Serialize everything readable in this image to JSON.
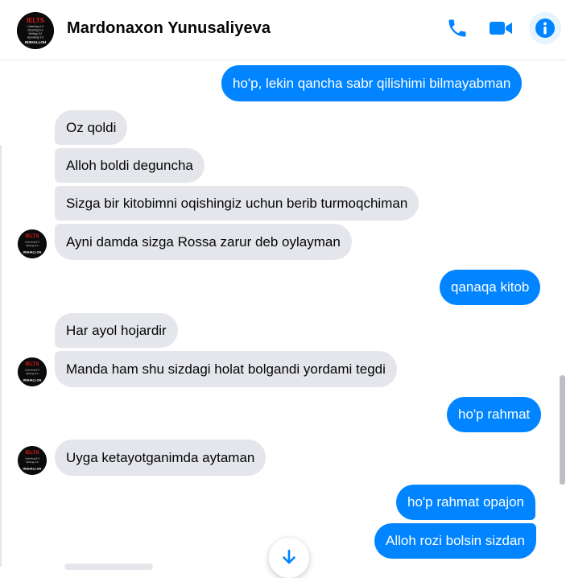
{
  "header": {
    "contact_name": "Mardonaxon Yunusaliyeva",
    "avatar_text": [
      "IELTS",
      "Listening 9.0",
      "Reading 9.0",
      "Writing 9.0",
      "Speaking 9.0",
      "INSHALLOH"
    ],
    "icons": [
      "phone-icon",
      "video-call-icon",
      "info-icon"
    ]
  },
  "colors": {
    "accent": "#0084ff",
    "incoming_bubble": "#e4e6eb",
    "text": "#050505"
  },
  "messages": [
    {
      "dir": "out",
      "text": "ho'p, lekin qancha sabr qilishimi bilmayabman"
    },
    {
      "dir": "in",
      "text": "Oz qoldi"
    },
    {
      "dir": "in",
      "text": "Alloh boldi deguncha"
    },
    {
      "dir": "in",
      "text": "Sizga bir kitobimni oqishingiz uchun berib turmoqchiman"
    },
    {
      "dir": "in",
      "text": "Ayni damda sizga Rossa zarur deb oylayman"
    },
    {
      "dir": "out",
      "text": "qanaqa kitob"
    },
    {
      "dir": "in",
      "text": "Har ayol hojardir"
    },
    {
      "dir": "in",
      "text": "Manda ham shu sizdagi holat bolgandi yordami tegdi"
    },
    {
      "dir": "out",
      "text": "ho'p rahmat"
    },
    {
      "dir": "in",
      "text": "Uyga ketayotganimda aytaman"
    },
    {
      "dir": "out",
      "text": "ho'p rahmat opajon"
    },
    {
      "dir": "out",
      "text": "Alloh rozi bolsin sizdan"
    }
  ],
  "scroll_down_icon": "arrow-down-icon"
}
